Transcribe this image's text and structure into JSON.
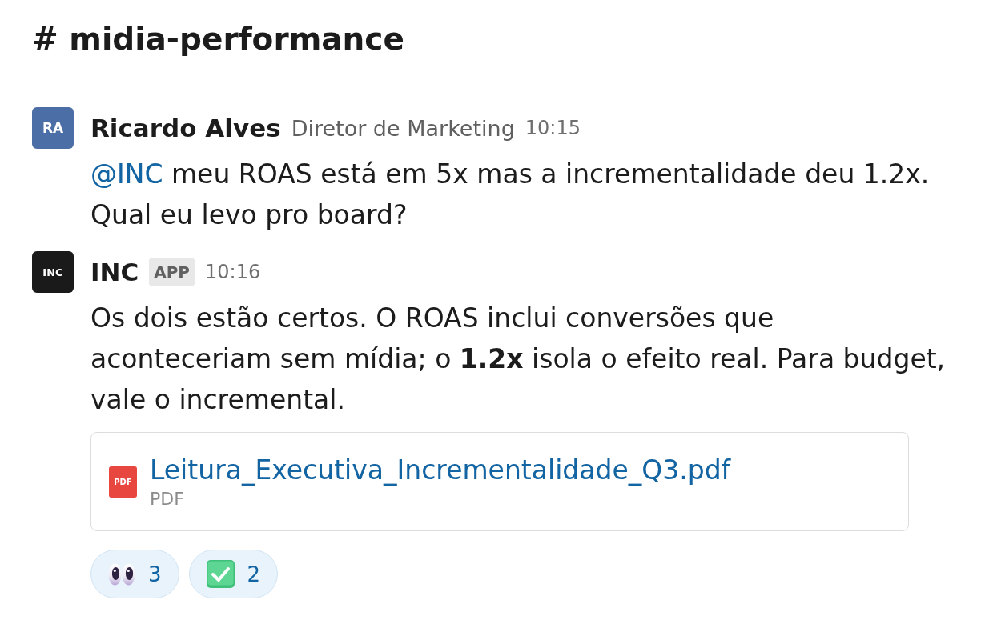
{
  "channel": {
    "title": "# midia-performance"
  },
  "messages": [
    {
      "initials": "RA",
      "color": "#4a6ea5",
      "author": "Ricardo Alves",
      "subtitle": "Diretor de Marketing",
      "time": "10:15",
      "mention": "@INC",
      "text": "meu ROAS está em 5x mas a incrementalidade deu 1.2x. Qual eu levo pro board?"
    },
    {
      "initials": "INC",
      "color": "#1a1a1a",
      "author": "INC",
      "badge": "APP",
      "time": "10:16",
      "text": "Os dois estão certos. O ROAS inclui conversões que aconteceriam sem mídia; o **1.2x** isola o efeito real. Para budget, vale o incremental.",
      "attachment": {
        "icon_label": "PDF",
        "name": "Leitura_Executiva_Incrementalidade_Q3.pdf",
        "type": "PDF"
      },
      "reactions": [
        {
          "kind": "eyes",
          "count": "3",
          "selected": true
        },
        {
          "kind": "check",
          "count": "2",
          "selected": true
        }
      ]
    }
  ]
}
